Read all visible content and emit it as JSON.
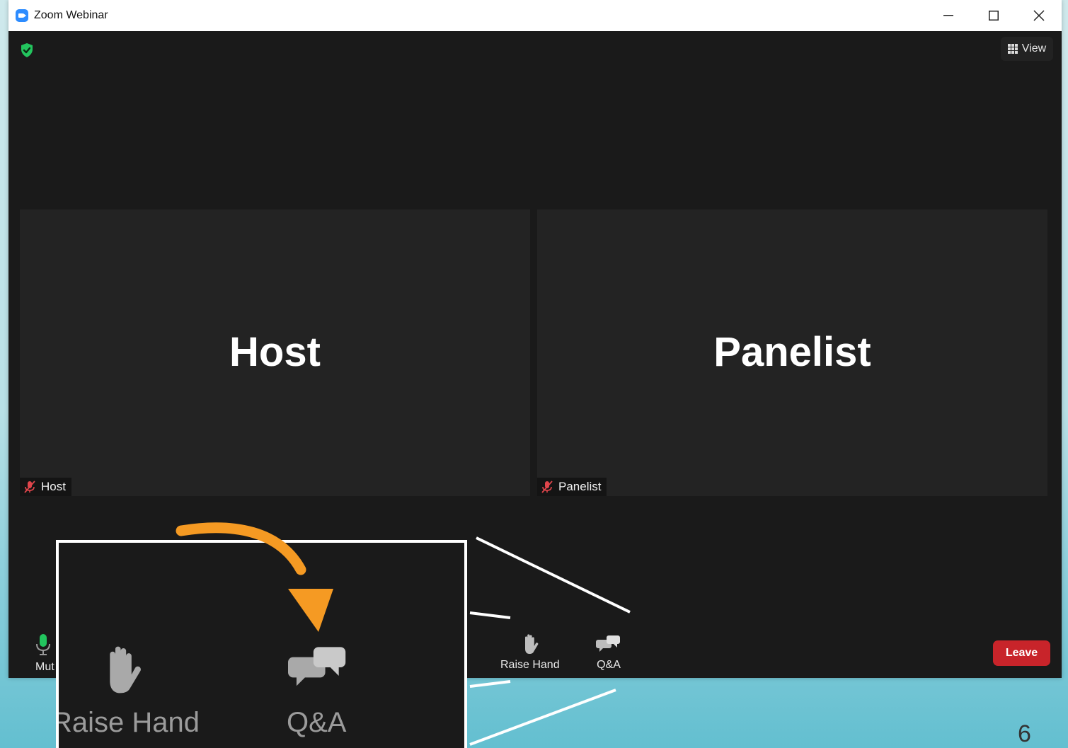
{
  "window": {
    "title": "Zoom Webinar",
    "controls": {
      "minimize": "—",
      "maximize": "☐",
      "close": "✕"
    }
  },
  "header": {
    "view_label": "View"
  },
  "tiles": [
    {
      "big_name": "Host",
      "label": "Host"
    },
    {
      "big_name": "Panelist",
      "label": "Panelist"
    }
  ],
  "toolbar": {
    "mute_label": "Mut",
    "raise_hand_label": "Raise Hand",
    "qa_label": "Q&A",
    "leave_label": "Leave"
  },
  "zoom_callout": {
    "raise_hand_label": "Raise Hand",
    "qa_label": "Q&A"
  },
  "slide_number": "6",
  "colors": {
    "accent": "#2d8cff",
    "leave": "#c8242a",
    "shield": "#23c55e",
    "muted_mic": "#e0454b",
    "arrow": "#f59a23",
    "mic_on": "#22c55e"
  },
  "icons": [
    "zoom-app-icon",
    "shield-icon",
    "grid-icon",
    "muted-mic-icon",
    "mic-icon",
    "raise-hand-icon",
    "qa-icon",
    "arrow-icon"
  ]
}
